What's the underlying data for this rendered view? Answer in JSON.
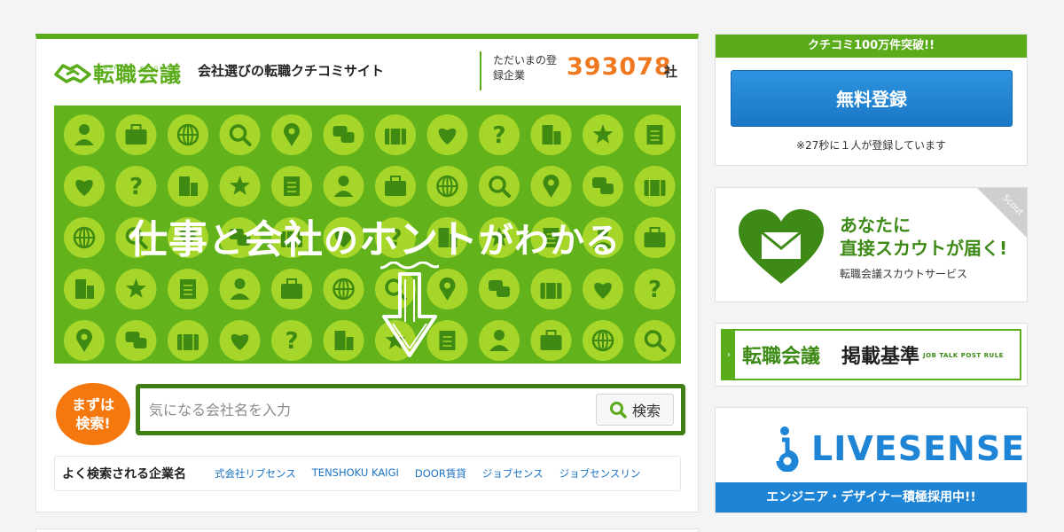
{
  "header": {
    "logo_text": "転職会議",
    "logo_sub": "TENSHOKU KAIGI",
    "tagline": "会社選びの転職クチコミサイト",
    "registered_label": "ただいまの登録企業",
    "registered_count": "393078",
    "registered_unit": "社"
  },
  "hero": {
    "headline_parts": [
      "仕事",
      "と",
      "会社",
      "の",
      "ホント",
      "がわかる"
    ],
    "icon_names": [
      "person-icon",
      "briefcase-icon",
      "globe-icon",
      "search-icon",
      "pin-icon",
      "chat-icon",
      "suitcase-icon",
      "heart-icon",
      "question-icon",
      "building-icon",
      "star-icon",
      "document-icon"
    ]
  },
  "search": {
    "badge": "まずは検索!",
    "placeholder": "気になる会社名を入力",
    "button_label": "検索"
  },
  "popular": {
    "label": "よく検索される企業名",
    "links": [
      "式会社リブセンス",
      "TENSHOKU KAIGI",
      "DOOR賃貸",
      "ジョブセンス",
      "ジョブセンスリン"
    ]
  },
  "sidebar": {
    "register": {
      "banner": "クチコミ100万件突破!!",
      "button": "無料登録",
      "note": "※27秒に１人が登録しています"
    },
    "scout": {
      "line1": "あなたに",
      "line2": "直接スカウトが届く!",
      "sub": "転職会議スカウトサービス",
      "corner": "Scout"
    },
    "criteria": {
      "title": "転職会議",
      "title2": "掲載基準",
      "english": "JOB TALK POST RULE"
    },
    "livesense": {
      "logo": "LIVESENSE",
      "banner": "エンジニア・デザイナー積極採用中!!"
    }
  },
  "colors": {
    "brand_green": "#5bac1b",
    "dark_green": "#3f7e12",
    "orange": "#f0781e",
    "blue": "#1e84d6"
  }
}
